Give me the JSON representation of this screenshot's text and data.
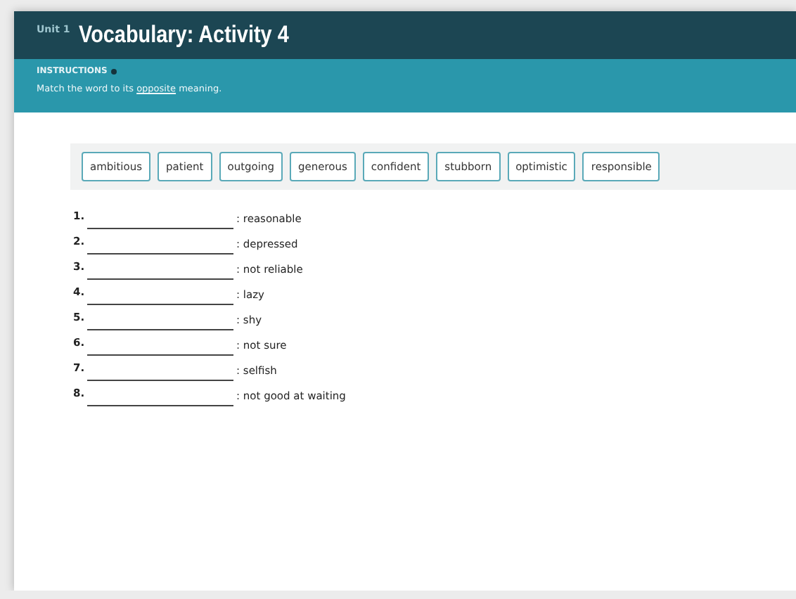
{
  "header": {
    "unit": "Unit 1",
    "title": "Vocabulary: Activity 4"
  },
  "instructions": {
    "label": "INSTRUCTIONS",
    "before": "Match the word to its ",
    "link": "opposite",
    "after": " meaning."
  },
  "word_bank": [
    "ambitious",
    "patient",
    "outgoing",
    "generous",
    "confident",
    "stubborn",
    "optimistic",
    "responsible"
  ],
  "questions": [
    {
      "number": "1.",
      "meaning": ": reasonable"
    },
    {
      "number": "2.",
      "meaning": ": depressed"
    },
    {
      "number": "3.",
      "meaning": ": not reliable"
    },
    {
      "number": "4.",
      "meaning": ": lazy"
    },
    {
      "number": "5.",
      "meaning": ": shy"
    },
    {
      "number": "6.",
      "meaning": ": not sure"
    },
    {
      "number": "7.",
      "meaning": ": selfish"
    },
    {
      "number": "8.",
      "meaning": ": not good at waiting"
    }
  ]
}
